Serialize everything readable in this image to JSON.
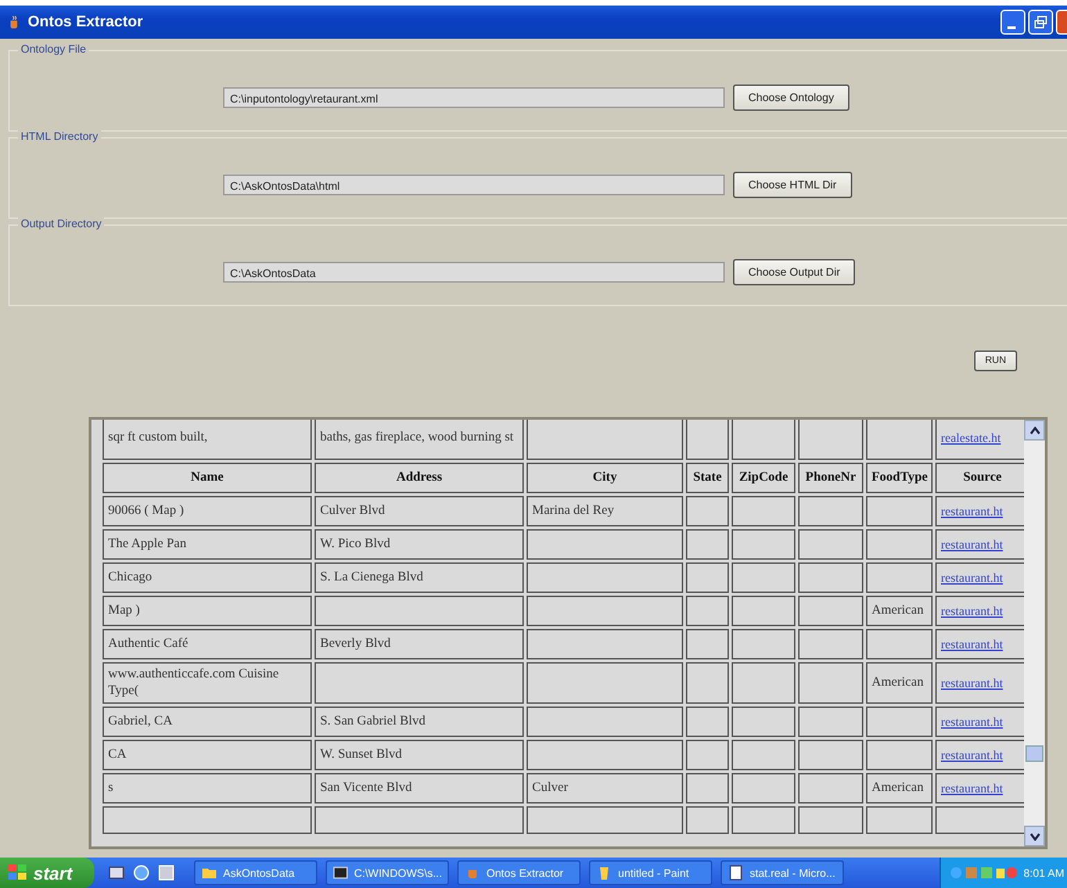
{
  "window": {
    "title": "Ontos Extractor"
  },
  "sections": [
    {
      "label": "Ontology File",
      "path": "C:\\inputontology\\retaurant.xml",
      "button": "Choose Ontology"
    },
    {
      "label": "HTML Directory",
      "path": "C:\\AskOntosData\\html",
      "button": "Choose HTML Dir"
    },
    {
      "label": "Output Directory",
      "path": "C:\\AskOntosData",
      "button": "Choose Output Dir"
    }
  ],
  "run_button": "RUN",
  "results": {
    "partial_row": {
      "cells": [
        "sqr ft custom built,",
        "baths, gas fireplace, wood burning st",
        "",
        "",
        "",
        "",
        ""
      ],
      "source": "realestate.ht"
    },
    "columns": [
      "Name",
      "Address",
      "City",
      "State",
      "ZipCode",
      "PhoneNr",
      "FoodType",
      "Source"
    ],
    "rows": [
      {
        "cells": [
          "90066 ( Map )",
          "Culver Blvd",
          "Marina del Rey",
          "",
          "",
          "",
          ""
        ],
        "source": "restaurant.ht"
      },
      {
        "cells": [
          "The Apple Pan",
          "W. Pico Blvd",
          "",
          "",
          "",
          "",
          ""
        ],
        "source": "restaurant.ht"
      },
      {
        "cells": [
          "Chicago",
          "S. La Cienega Blvd",
          "",
          "",
          "",
          "",
          ""
        ],
        "source": "restaurant.ht"
      },
      {
        "cells": [
          "Map )",
          "",
          "",
          "",
          "",
          "",
          "American"
        ],
        "source": "restaurant.ht"
      },
      {
        "cells": [
          "Authentic Café",
          "Beverly Blvd",
          "",
          "",
          "",
          "",
          ""
        ],
        "source": "restaurant.ht"
      },
      {
        "cells": [
          "www.authenticcafe.com Cuisine Type(",
          "",
          "",
          "",
          "",
          "",
          "American"
        ],
        "source": "restaurant.ht"
      },
      {
        "cells": [
          "Gabriel, CA",
          "S. San Gabriel Blvd",
          "",
          "",
          "",
          "",
          ""
        ],
        "source": "restaurant.ht"
      },
      {
        "cells": [
          "CA",
          "W. Sunset Blvd",
          "",
          "",
          "",
          "",
          ""
        ],
        "source": "restaurant.ht"
      },
      {
        "cells": [
          "s",
          "San Vicente Blvd",
          "Culver",
          "",
          "",
          "",
          "American"
        ],
        "source": "restaurant.ht"
      }
    ]
  },
  "taskbar": {
    "start": "start",
    "tasks": [
      {
        "label": "AskOntosData",
        "kind": "folder"
      },
      {
        "label": "C:\\WINDOWS\\s...",
        "kind": "console"
      },
      {
        "label": "Ontos Extractor",
        "kind": "app"
      },
      {
        "label": "untitled - Paint",
        "kind": "paint"
      },
      {
        "label": "stat.real - Micro...",
        "kind": "doc"
      }
    ],
    "clock": "8:01 AM"
  }
}
